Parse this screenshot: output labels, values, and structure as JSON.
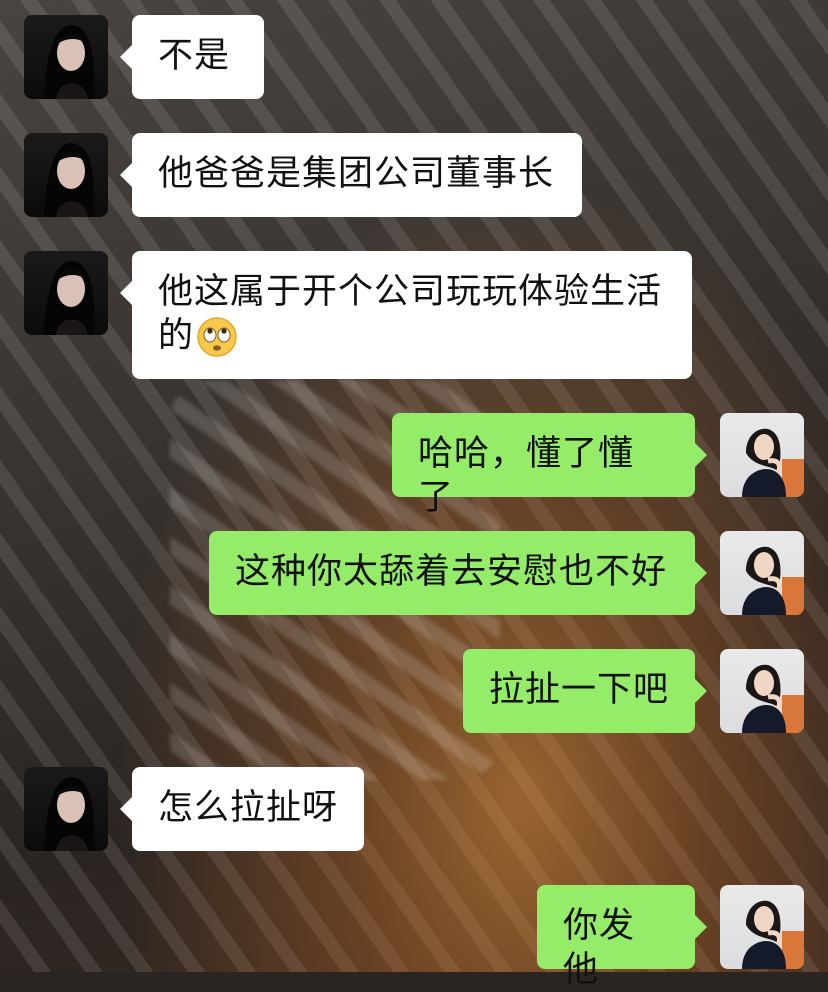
{
  "messages": [
    {
      "side": "left",
      "text": "不是"
    },
    {
      "side": "left",
      "text": "他爸爸是集团公司董事长"
    },
    {
      "side": "left",
      "text_line1": "他这属于开个公司玩玩体验生活",
      "text_line2": "的",
      "emoji": "rolling-eyes-emoji"
    },
    {
      "side": "right",
      "text": "哈哈，懂了懂了"
    },
    {
      "side": "right",
      "text": "这种你太舔着去安慰也不好"
    },
    {
      "side": "right",
      "text": "拉扯一下吧"
    },
    {
      "side": "left",
      "text": "怎么拉扯呀"
    },
    {
      "side": "right",
      "text": "你发他"
    }
  ],
  "colors": {
    "incoming_bubble": "#ffffff",
    "outgoing_bubble": "#95ec69"
  }
}
